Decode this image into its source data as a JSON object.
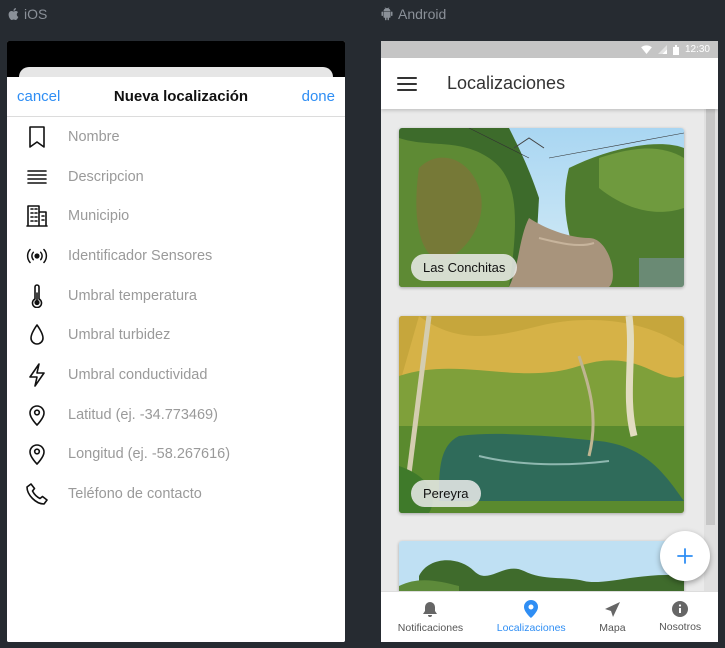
{
  "platforms": {
    "ios": "iOS",
    "android": "Android"
  },
  "colors": {
    "accent": "#2f8ef4",
    "background": "#262b31"
  },
  "ios_form": {
    "cancel": "cancel",
    "title": "Nueva localización",
    "done": "done",
    "fields": [
      {
        "icon": "bookmark-icon",
        "placeholder": "Nombre"
      },
      {
        "icon": "lines-icon",
        "placeholder": "Descripcion"
      },
      {
        "icon": "building-icon",
        "placeholder": "Municipio"
      },
      {
        "icon": "sensor-signal-icon",
        "placeholder": "Identificador Sensores"
      },
      {
        "icon": "thermometer-icon",
        "placeholder": "Umbral temperatura"
      },
      {
        "icon": "water-drop-icon",
        "placeholder": "Umbral turbidez"
      },
      {
        "icon": "lightning-icon",
        "placeholder": "Umbral conductividad"
      },
      {
        "icon": "location-pin-icon",
        "placeholder": "Latitud (ej. -34.773469)"
      },
      {
        "icon": "location-pin-icon",
        "placeholder": "Longitud (ej. -58.267616)"
      },
      {
        "icon": "phone-icon",
        "placeholder": "Teléfono de contacto"
      }
    ]
  },
  "android_app": {
    "status_time": "12:30",
    "title": "Localizaciones",
    "cards": [
      {
        "label": "Las Conchitas"
      },
      {
        "label": "Pereyra"
      },
      {
        "label": ""
      }
    ],
    "fab_icon": "plus-icon",
    "tabs": [
      {
        "icon": "bell-icon",
        "label": "Notificaciones",
        "active": false
      },
      {
        "icon": "map-pin-icon",
        "label": "Localizaciones",
        "active": true
      },
      {
        "icon": "navigation-arrow-icon",
        "label": "Mapa",
        "active": false
      },
      {
        "icon": "info-icon",
        "label": "Nosotros",
        "active": false
      }
    ]
  }
}
